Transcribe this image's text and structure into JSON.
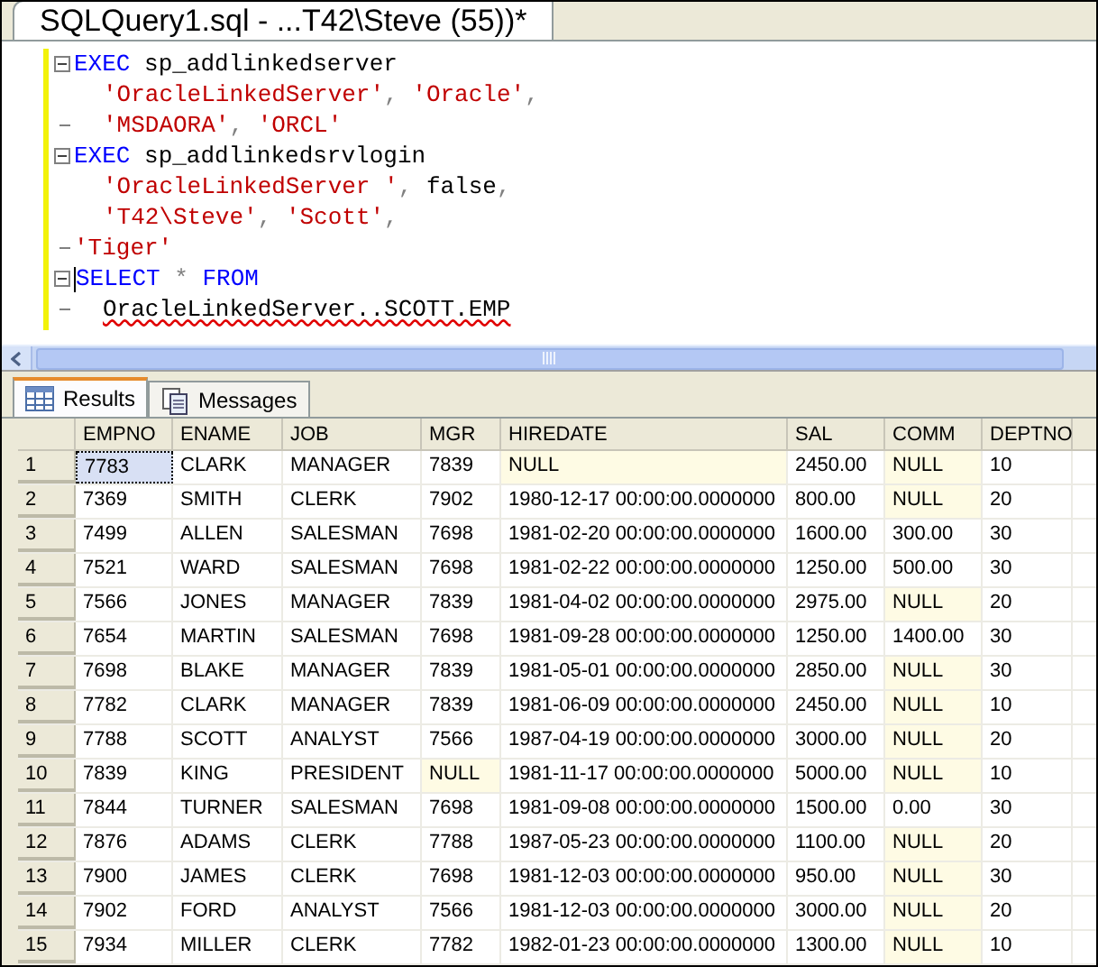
{
  "document_tab": {
    "title": "SQLQuery1.sql - ...T42\\Steve (55))*"
  },
  "editor": {
    "lines": [
      {
        "kind": "start",
        "indent": false,
        "cursor": false,
        "tokens": [
          {
            "kind": "keyword",
            "text": "EXEC"
          },
          {
            "kind": "plain",
            "text": " sp_addlinkedserver"
          }
        ]
      },
      {
        "kind": "none",
        "indent": true,
        "cursor": false,
        "tokens": [
          {
            "kind": "string",
            "text": "'OracleLinkedServer'"
          },
          {
            "kind": "operator",
            "text": ", "
          },
          {
            "kind": "string",
            "text": "'Oracle'"
          },
          {
            "kind": "operator",
            "text": ","
          }
        ]
      },
      {
        "kind": "end",
        "indent": true,
        "cursor": false,
        "tokens": [
          {
            "kind": "string",
            "text": "'MSDAORA'"
          },
          {
            "kind": "operator",
            "text": ", "
          },
          {
            "kind": "string",
            "text": "'ORCL'"
          }
        ]
      },
      {
        "kind": "start",
        "indent": false,
        "cursor": false,
        "tokens": [
          {
            "kind": "keyword",
            "text": "EXEC"
          },
          {
            "kind": "plain",
            "text": " sp_addlinkedsrvlogin"
          }
        ]
      },
      {
        "kind": "none",
        "indent": true,
        "cursor": false,
        "tokens": [
          {
            "kind": "string",
            "text": "'OracleLinkedServer '"
          },
          {
            "kind": "operator",
            "text": ", "
          },
          {
            "kind": "plain",
            "text": "false"
          },
          {
            "kind": "operator",
            "text": ","
          }
        ]
      },
      {
        "kind": "none",
        "indent": true,
        "cursor": false,
        "tokens": [
          {
            "kind": "string",
            "text": "'T42\\Steve'"
          },
          {
            "kind": "operator",
            "text": ", "
          },
          {
            "kind": "string",
            "text": "'Scott'"
          },
          {
            "kind": "operator",
            "text": ","
          }
        ]
      },
      {
        "kind": "end",
        "indent": false,
        "cursor": false,
        "tokens": [
          {
            "kind": "string",
            "text": "'Tiger'"
          }
        ]
      },
      {
        "kind": "start",
        "indent": false,
        "cursor": true,
        "tokens": [
          {
            "kind": "keyword",
            "text": "SELECT"
          },
          {
            "kind": "operator",
            "text": " * "
          },
          {
            "kind": "keyword",
            "text": "FROM"
          }
        ]
      },
      {
        "kind": "end",
        "indent": true,
        "cursor": false,
        "tokens": [
          {
            "kind": "error",
            "text": "OracleLinkedServer..SCOTT.EMP"
          }
        ]
      }
    ]
  },
  "result_tabs": [
    {
      "label": "Results",
      "selected": true
    },
    {
      "label": "Messages",
      "selected": false
    }
  ],
  "table": {
    "columns": [
      "EMPNO",
      "ENAME",
      "JOB",
      "MGR",
      "HIREDATE",
      "SAL",
      "COMM",
      "DEPTNO"
    ],
    "rows": [
      {
        "number": "1",
        "current": true,
        "cells": [
          "7783",
          "CLARK",
          "MANAGER",
          "7839",
          {
            "text": "NULL",
            "null": true
          },
          "2450.00",
          {
            "text": "NULL",
            "null": true
          },
          "10"
        ]
      },
      {
        "number": "2",
        "current": false,
        "cells": [
          "7369",
          "SMITH",
          "CLERK",
          "7902",
          "1980-12-17 00:00:00.0000000",
          "800.00",
          {
            "text": "NULL",
            "null": true
          },
          "20"
        ]
      },
      {
        "number": "3",
        "current": false,
        "cells": [
          "7499",
          "ALLEN",
          "SALESMAN",
          "7698",
          "1981-02-20 00:00:00.0000000",
          "1600.00",
          "300.00",
          "30"
        ]
      },
      {
        "number": "4",
        "current": false,
        "cells": [
          "7521",
          "WARD",
          "SALESMAN",
          "7698",
          "1981-02-22 00:00:00.0000000",
          "1250.00",
          "500.00",
          "30"
        ]
      },
      {
        "number": "5",
        "current": false,
        "cells": [
          "7566",
          "JONES",
          "MANAGER",
          "7839",
          "1981-04-02 00:00:00.0000000",
          "2975.00",
          {
            "text": "NULL",
            "null": true
          },
          "20"
        ]
      },
      {
        "number": "6",
        "current": false,
        "cells": [
          "7654",
          "MARTIN",
          "SALESMAN",
          "7698",
          "1981-09-28 00:00:00.0000000",
          "1250.00",
          "1400.00",
          "30"
        ]
      },
      {
        "number": "7",
        "current": false,
        "cells": [
          "7698",
          "BLAKE",
          "MANAGER",
          "7839",
          "1981-05-01 00:00:00.0000000",
          "2850.00",
          {
            "text": "NULL",
            "null": true
          },
          "30"
        ]
      },
      {
        "number": "8",
        "current": false,
        "cells": [
          "7782",
          "CLARK",
          "MANAGER",
          "7839",
          "1981-06-09 00:00:00.0000000",
          "2450.00",
          {
            "text": "NULL",
            "null": true
          },
          "10"
        ]
      },
      {
        "number": "9",
        "current": false,
        "cells": [
          "7788",
          "SCOTT",
          "ANALYST",
          "7566",
          "1987-04-19 00:00:00.0000000",
          "3000.00",
          {
            "text": "NULL",
            "null": true
          },
          "20"
        ]
      },
      {
        "number": "10",
        "current": false,
        "cells": [
          "7839",
          "KING",
          "PRESIDENT",
          {
            "text": "NULL",
            "null": true
          },
          "1981-11-17 00:00:00.0000000",
          "5000.00",
          {
            "text": "NULL",
            "null": true
          },
          "10"
        ]
      },
      {
        "number": "11",
        "current": false,
        "cells": [
          "7844",
          "TURNER",
          "SALESMAN",
          "7698",
          "1981-09-08 00:00:00.0000000",
          "1500.00",
          "0.00",
          "30"
        ]
      },
      {
        "number": "12",
        "current": false,
        "cells": [
          "7876",
          "ADAMS",
          "CLERK",
          "7788",
          "1987-05-23 00:00:00.0000000",
          "1100.00",
          {
            "text": "NULL",
            "null": true
          },
          "20"
        ]
      },
      {
        "number": "13",
        "current": false,
        "cells": [
          "7900",
          "JAMES",
          "CLERK",
          "7698",
          "1981-12-03 00:00:00.0000000",
          "950.00",
          {
            "text": "NULL",
            "null": true
          },
          "30"
        ]
      },
      {
        "number": "14",
        "current": false,
        "cells": [
          "7902",
          "FORD",
          "ANALYST",
          "7566",
          "1981-12-03 00:00:00.0000000",
          "3000.00",
          {
            "text": "NULL",
            "null": true
          },
          "20"
        ]
      },
      {
        "number": "15",
        "current": false,
        "cells": [
          "7934",
          "MILLER",
          "CLERK",
          "7782",
          "1982-01-23 00:00:00.0000000",
          "1300.00",
          {
            "text": "NULL",
            "null": true
          },
          "10"
        ]
      }
    ]
  }
}
